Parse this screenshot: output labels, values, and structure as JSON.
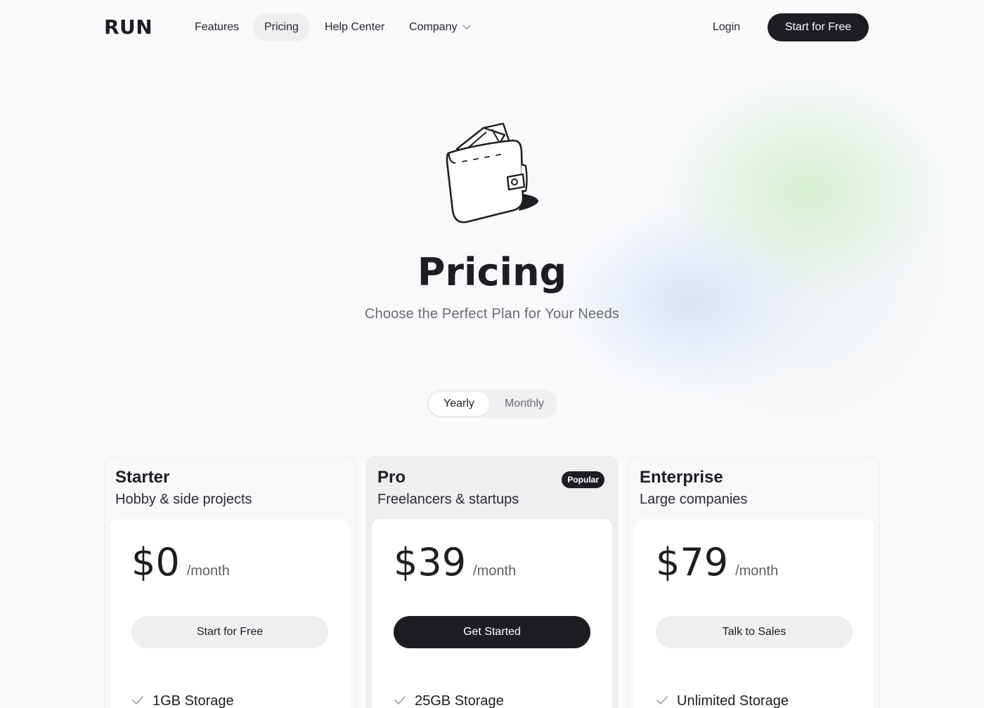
{
  "brand": {
    "logo_text": "RUN"
  },
  "nav": {
    "links": [
      {
        "label": "Features"
      },
      {
        "label": "Pricing",
        "active": true
      },
      {
        "label": "Help Center"
      },
      {
        "label": "Company",
        "has_dropdown": true
      }
    ],
    "login_label": "Login",
    "cta_label": "Start for Free"
  },
  "hero": {
    "icon": "wallet-illustration",
    "title": "Pricing",
    "subtitle": "Choose the Perfect Plan for Your Needs"
  },
  "billing_toggle": {
    "options": [
      "Yearly",
      "Monthly"
    ],
    "selected": "Yearly"
  },
  "plans": [
    {
      "name": "Starter",
      "description": "Hobby & side projects",
      "price": "$0",
      "period": "/month",
      "button_label": "Start for Free",
      "features": [
        "1GB Storage"
      ]
    },
    {
      "name": "Pro",
      "description": "Freelancers & startups",
      "badge": "Popular",
      "price": "$39",
      "period": "/month",
      "button_label": "Get Started",
      "features": [
        "25GB Storage"
      ]
    },
    {
      "name": "Enterprise",
      "description": "Large companies",
      "price": "$79",
      "period": "/month",
      "button_label": "Talk to Sales",
      "features": [
        "Unlimited Storage"
      ]
    }
  ],
  "colors": {
    "background": "#f8f9fb",
    "primary_dark": "#1d1e22",
    "muted_text": "#6a6b70",
    "accent_green_glow": "#c8f0be",
    "accent_blue_glow": "#c8dcf5"
  }
}
